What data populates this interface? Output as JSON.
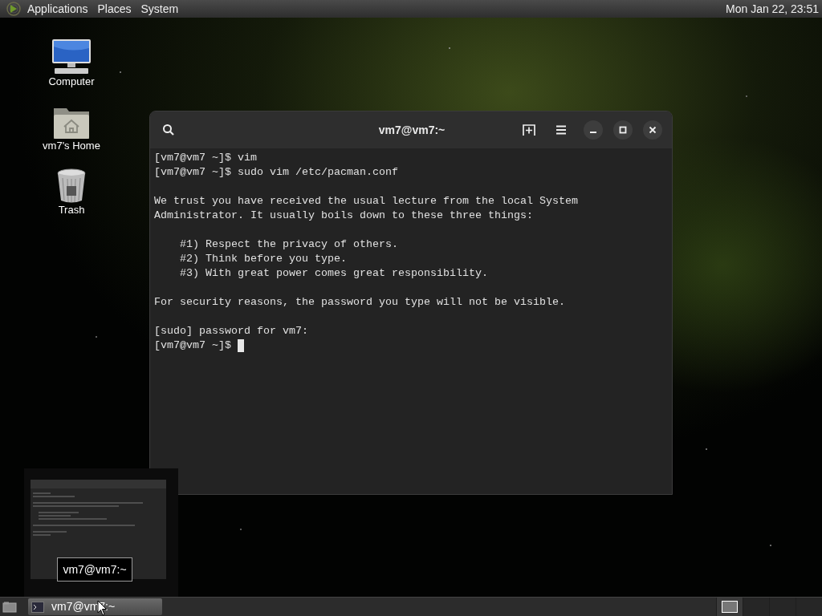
{
  "top_panel": {
    "menus": [
      {
        "label": "Applications"
      },
      {
        "label": "Places"
      },
      {
        "label": "System"
      }
    ],
    "clock": "Mon Jan 22, 23:51"
  },
  "desktop_icons": [
    {
      "label": "Computer",
      "kind": "computer"
    },
    {
      "label": "vm7's Home",
      "kind": "home"
    },
    {
      "label": "Trash",
      "kind": "trash"
    }
  ],
  "terminal": {
    "title": "vm7@vm7:~",
    "blocks": [
      [
        "[vm7@vm7 ~]$ vim",
        "[vm7@vm7 ~]$ sudo vim /etc/pacman.conf"
      ],
      [
        "We trust you have received the usual lecture from the local System",
        "Administrator. It usually boils down to these three things:"
      ],
      [
        "    #1) Respect the privacy of others.",
        "    #2) Think before you type.",
        "    #3) With great power comes great responsibility."
      ],
      [
        "For security reasons, the password you type will not be visible."
      ],
      [
        "[sudo] password for vm7:",
        "[vm7@vm7 ~]$ "
      ]
    ]
  },
  "window_preview": {
    "tooltip": "vm7@vm7:~"
  },
  "taskbar": {
    "tasks": [
      {
        "label": "vm7@vm7:~",
        "selected": true
      }
    ],
    "workspaces": [
      {
        "selected": true
      },
      {
        "selected": false
      },
      {
        "selected": false
      },
      {
        "selected": false
      }
    ]
  }
}
